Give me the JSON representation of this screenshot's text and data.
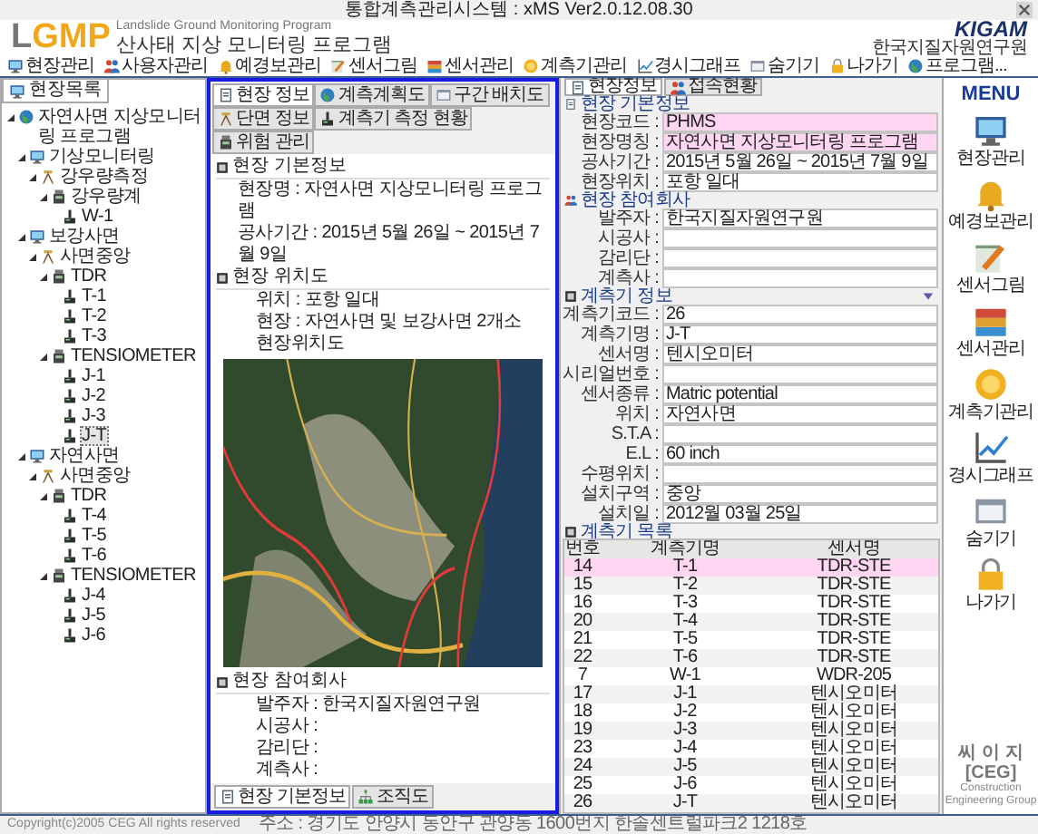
{
  "window": {
    "title": "통합계측관리시스템 : xMS Ver2.0.12.08.30"
  },
  "header": {
    "logo": "LGMP",
    "subtitle": "Landslide Ground Monitoring Program",
    "program_name": "산사태 지상 모니터링 프로그램",
    "org_logo": "KIGAM",
    "org_name": "한국지질자원연구원"
  },
  "toolbar": [
    "현장관리",
    "사용자관리",
    "예경보관리",
    "센서그림",
    "센서관리",
    "계측기관리",
    "경시그래프",
    "숨기기",
    "나가기",
    "프로그램..."
  ],
  "site_tree": {
    "tab": "현장목록",
    "nodes": [
      {
        "label": "자연사면 지상모니터링 프로그램",
        "expanded": true,
        "selected": false,
        "children": [
          {
            "label": "기상모니터링",
            "expanded": true,
            "selected": false,
            "children": [
              {
                "label": "강우량측정",
                "expanded": true,
                "selected": false,
                "children": [
                  {
                    "label": "강우량계",
                    "expanded": true,
                    "selected": false,
                    "children": [
                      {
                        "label": "W-1",
                        "selected": false
                      }
                    ]
                  }
                ]
              }
            ]
          },
          {
            "label": "보강사면",
            "expanded": true,
            "selected": false,
            "children": [
              {
                "label": "사면중앙",
                "expanded": true,
                "selected": false,
                "children": [
                  {
                    "label": "TDR",
                    "expanded": true,
                    "selected": false,
                    "children": [
                      {
                        "label": "T-1",
                        "selected": false
                      },
                      {
                        "label": "T-2",
                        "selected": false
                      },
                      {
                        "label": "T-3",
                        "selected": false
                      }
                    ]
                  },
                  {
                    "label": "TENSIOMETER",
                    "expanded": true,
                    "selected": false,
                    "children": [
                      {
                        "label": "J-1",
                        "selected": false
                      },
                      {
                        "label": "J-2",
                        "selected": false
                      },
                      {
                        "label": "J-3",
                        "selected": false
                      },
                      {
                        "label": "J-T",
                        "selected": true
                      }
                    ]
                  }
                ]
              }
            ]
          },
          {
            "label": "자연사면",
            "expanded": true,
            "selected": false,
            "children": [
              {
                "label": "사면중앙",
                "expanded": true,
                "selected": false,
                "children": [
                  {
                    "label": "TDR",
                    "expanded": true,
                    "selected": false,
                    "children": [
                      {
                        "label": "T-4",
                        "selected": false
                      },
                      {
                        "label": "T-5",
                        "selected": false
                      },
                      {
                        "label": "T-6",
                        "selected": false
                      }
                    ]
                  },
                  {
                    "label": "TENSIOMETER",
                    "expanded": true,
                    "selected": false,
                    "children": [
                      {
                        "label": "J-4",
                        "selected": false
                      },
                      {
                        "label": "J-5",
                        "selected": false
                      },
                      {
                        "label": "J-6",
                        "selected": false
                      }
                    ]
                  }
                ]
              }
            ]
          }
        ]
      }
    ]
  },
  "center": {
    "tabs": [
      {
        "label": "현장 정보",
        "selected": true
      },
      {
        "label": "계측계획도",
        "selected": false
      },
      {
        "label": "구간 배치도",
        "selected": false
      },
      {
        "label": "단면 정보",
        "selected": false
      },
      {
        "label": "계측기 측정 현황",
        "selected": false
      },
      {
        "label": "위험 관리",
        "selected": false
      }
    ],
    "basic_info": {
      "title": "현장 기본정보",
      "rows": [
        {
          "label": "현장명 :",
          "value": "자연사면 지상모니터링 프로그램"
        },
        {
          "label": "공사기간 :",
          "value": "2015년 5월 26일 ~ 2015년 7월 9일"
        }
      ]
    },
    "location": {
      "title": "현장 위치도",
      "rows": [
        {
          "label": "위치 :",
          "value": "포항 일대"
        },
        {
          "label": "현장 :",
          "value": "자연사면 및 보강사면 2개소"
        }
      ],
      "map_caption": "현장위치도"
    },
    "companies": {
      "title": "현장 참여회사",
      "rows": [
        {
          "label": "발주자 :",
          "value": "한국지질자원연구원"
        },
        {
          "label": "시공사 :"
        },
        {
          "label": "감리단 :"
        },
        {
          "label": "계측사 :"
        }
      ]
    },
    "bottom_tabs": [
      {
        "label": "현장 기본정보",
        "selected": true
      },
      {
        "label": "조직도",
        "selected": false
      }
    ]
  },
  "right": {
    "tabs": [
      {
        "label": "현장정보",
        "selected": true
      },
      {
        "label": "접속현황",
        "selected": false
      }
    ],
    "sections": [
      {
        "title": "현장 기본정보",
        "fields": [
          {
            "label": "현장코드 :",
            "value": "PHMS",
            "highlighted": true
          },
          {
            "label": "현장명칭 :",
            "value": "자연사면 지상모니터링 프로그램",
            "highlighted": true
          },
          {
            "label": "공사기간 :",
            "value": "2015년 5월 26일 ~ 2015년 7월 9일",
            "highlighted": false
          },
          {
            "label": "현장위치 :",
            "value": "포항 일대",
            "highlighted": false
          }
        ]
      },
      {
        "title": "현장 참여회사",
        "fields": [
          {
            "label": "발주자 :",
            "value": "한국지질자원연구원",
            "highlighted": false
          },
          {
            "label": "시공사 :",
            "highlighted": false
          },
          {
            "label": "감리단 :",
            "highlighted": false
          },
          {
            "label": "계측사 :",
            "highlighted": false
          }
        ]
      },
      {
        "title": "계측기 정보",
        "expanded": true,
        "fields": [
          {
            "label": "계측기코드 :",
            "value": "26",
            "highlighted": false
          },
          {
            "label": "계측기명 :",
            "value": "J-T",
            "highlighted": false
          },
          {
            "label": "센서명 :",
            "value": "텐시오미터",
            "highlighted": false
          },
          {
            "label": "시리얼번호 :",
            "highlighted": false
          },
          {
            "label": "센서종류 :",
            "value": "Matric potential",
            "highlighted": false
          },
          {
            "label": "위치 :",
            "value": "자연사면",
            "highlighted": false
          },
          {
            "label": "S.T.A :",
            "highlighted": false
          },
          {
            "label": "E.L :",
            "value": "60 inch",
            "highlighted": false
          },
          {
            "label": "수평위치 :",
            "highlighted": false
          },
          {
            "label": "설치구역 :",
            "value": "중앙",
            "highlighted": false
          },
          {
            "label": "설치일 :",
            "value": "2012월 03월 25일",
            "highlighted": false
          }
        ]
      }
    ],
    "instrument_list": {
      "title": "계측기 목록",
      "columns": [
        "번호",
        "계측기명",
        "센서명"
      ],
      "rows": [
        {
          "cells": [
            "14",
            "T-1",
            "TDR-STE"
          ],
          "selected": true
        },
        {
          "cells": [
            "15",
            "T-2",
            "TDR-STE"
          ],
          "selected": false
        },
        {
          "cells": [
            "16",
            "T-3",
            "TDR-STE"
          ],
          "selected": false
        },
        {
          "cells": [
            "20",
            "T-4",
            "TDR-STE"
          ],
          "selected": false
        },
        {
          "cells": [
            "21",
            "T-5",
            "TDR-STE"
          ],
          "selected": false
        },
        {
          "cells": [
            "22",
            "T-6",
            "TDR-STE"
          ],
          "selected": false
        },
        {
          "cells": [
            "7",
            "W-1",
            "WDR-205"
          ],
          "selected": false
        },
        {
          "cells": [
            "17",
            "J-1",
            "텐시오미터"
          ],
          "selected": false
        },
        {
          "cells": [
            "18",
            "J-2",
            "텐시오미터"
          ],
          "selected": false
        },
        {
          "cells": [
            "19",
            "J-3",
            "텐시오미터"
          ],
          "selected": false
        },
        {
          "cells": [
            "23",
            "J-4",
            "텐시오미터"
          ],
          "selected": false
        },
        {
          "cells": [
            "24",
            "J-5",
            "텐시오미터"
          ],
          "selected": false
        },
        {
          "cells": [
            "25",
            "J-6",
            "텐시오미터"
          ],
          "selected": false
        },
        {
          "cells": [
            "26",
            "J-T",
            "텐시오미터"
          ],
          "selected": false
        }
      ]
    }
  },
  "menu": {
    "title": "MENU",
    "items": [
      "현장관리",
      "예경보관리",
      "센서그림",
      "센서관리",
      "계측기관리",
      "경시그래프",
      "숨기기",
      "나가기"
    ]
  },
  "footer": {
    "copyright": "Copyright(c)2005 CEG All rights reserved",
    "address": "주소 : 경기도 안양시 동안구 관양동 1600번지 한솔센트럴파크2 1218호",
    "company": "씨 이 지 [CEG]",
    "company_en": "Construction Engineering Group"
  }
}
